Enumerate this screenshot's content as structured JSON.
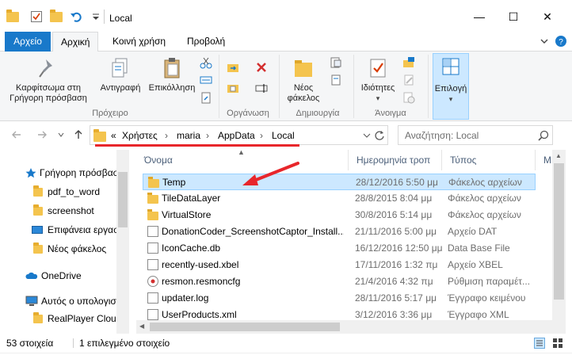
{
  "window": {
    "title": "Local",
    "controls": {
      "minimize": "—",
      "maximize": "☐",
      "close": "✕"
    }
  },
  "ribbon_tabs": [
    {
      "label": "Αρχείο"
    },
    {
      "label": "Αρχική"
    },
    {
      "label": "Κοινή χρήση"
    },
    {
      "label": "Προβολή"
    }
  ],
  "ribbon": {
    "pin_label": "Καρφίτσωμα στη Γρήγορη πρόσβαση",
    "copy_label": "Αντιγραφή",
    "paste_label": "Επικόλληση",
    "new_folder_label": "Νέος φάκελος",
    "properties_label": "Ιδιότητες",
    "select_label": "Επιλογή",
    "groups": {
      "clipboard": "Πρόχειρο",
      "organize": "Οργάνωση",
      "new": "Δημιουργία",
      "open": "Άνοιγμα"
    }
  },
  "address": {
    "prefix": "«",
    "crumbs": [
      "Χρήστες",
      "maria",
      "AppData",
      "Local"
    ],
    "search_placeholder": "Αναζήτηση: Local"
  },
  "nav": {
    "items": [
      {
        "label": "Γρήγορη πρόσβαση"
      },
      {
        "label": "pdf_to_word"
      },
      {
        "label": "screenshot"
      },
      {
        "label": "Επιφάνεια εργασίας"
      },
      {
        "label": "Νέος φάκελος"
      },
      {
        "label": "OneDrive"
      },
      {
        "label": "Αυτός ο υπολογιστής"
      },
      {
        "label": "RealPlayer Cloud"
      }
    ]
  },
  "columns": {
    "name": "Όνομα",
    "date": "Ημερομηνία τροπ",
    "type": "Τύπος",
    "size": "Μ"
  },
  "files": [
    {
      "name": "Temp",
      "date": "28/12/2016 5:50 μμ",
      "type": "Φάκελος αρχείων",
      "kind": "folder"
    },
    {
      "name": "TileDataLayer",
      "date": "28/8/2015 8:04 μμ",
      "type": "Φάκελος αρχείων",
      "kind": "folder"
    },
    {
      "name": "VirtualStore",
      "date": "30/8/2016 5:14 μμ",
      "type": "Φάκελος αρχείων",
      "kind": "folder"
    },
    {
      "name": "DonationCoder_ScreenshotCaptor_Install...",
      "date": "21/11/2016 5:00 μμ",
      "type": "Αρχείο DAT",
      "kind": "file"
    },
    {
      "name": "IconCache.db",
      "date": "16/12/2016 12:50 μμ",
      "type": "Data Base File",
      "kind": "file"
    },
    {
      "name": "recently-used.xbel",
      "date": "17/11/2016 1:32 πμ",
      "type": "Αρχείο XBEL",
      "kind": "file"
    },
    {
      "name": "resmon.resmoncfg",
      "date": "21/4/2016 4:32 πμ",
      "type": "Ρύθμιση παραμέτ...",
      "kind": "cfg"
    },
    {
      "name": "updater.log",
      "date": "28/11/2016 5:17 μμ",
      "type": "Έγγραφο κειμένου",
      "kind": "file"
    },
    {
      "name": "UserProducts.xml",
      "date": "3/12/2016 3:36 μμ",
      "type": "Έγγραφο XML",
      "kind": "file"
    }
  ],
  "status": {
    "count": "53 στοιχεία",
    "selected": "1 επιλεγμένο στοιχείο"
  },
  "colors": {
    "accent": "#1979ca",
    "selection": "#cce8ff",
    "annotation": "#e8262b"
  }
}
